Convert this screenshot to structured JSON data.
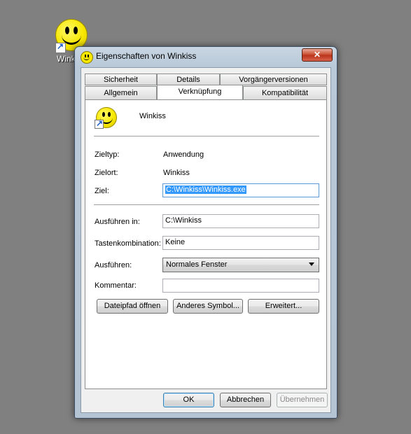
{
  "desktop": {
    "icon_label": "Wink"
  },
  "window": {
    "title": "Eigenschaften von Winkiss",
    "close_glyph": "✕"
  },
  "tabs": {
    "row1": [
      {
        "label": "Sicherheit"
      },
      {
        "label": "Details"
      },
      {
        "label": "Vorgängerversionen"
      }
    ],
    "row2": [
      {
        "label": "Allgemein"
      },
      {
        "label": "Verknüpfung",
        "active": true
      },
      {
        "label": "Kompatibilität"
      }
    ]
  },
  "shortcut": {
    "name": "Winkiss",
    "zieltyp_label": "Zieltyp:",
    "zieltyp_value": "Anwendung",
    "zielort_label": "Zielort:",
    "zielort_value": "Winkiss",
    "ziel_label": "Ziel:",
    "ziel_value": "C:\\Winkiss\\Winkiss.exe",
    "ausfuehren_in_label": "Ausführen in:",
    "ausfuehren_in_value": "C:\\Winkiss",
    "tasten_label": "Tastenkombination:",
    "tasten_value": "Keine",
    "ausfuehren_label": "Ausführen:",
    "ausfuehren_value": "Normales Fenster",
    "kommentar_label": "Kommentar:",
    "kommentar_value": ""
  },
  "panel_buttons": {
    "open_path": "Dateipfad öffnen",
    "change_icon": "Anderes Symbol...",
    "advanced": "Erweitert..."
  },
  "dialog_buttons": {
    "ok": "OK",
    "cancel": "Abbrechen",
    "apply": "Übernehmen"
  },
  "icons": {
    "app_icon": "smiley-icon",
    "shortcut_overlay": "shortcut-arrow-icon",
    "dropdown": "chevron-down-icon"
  }
}
